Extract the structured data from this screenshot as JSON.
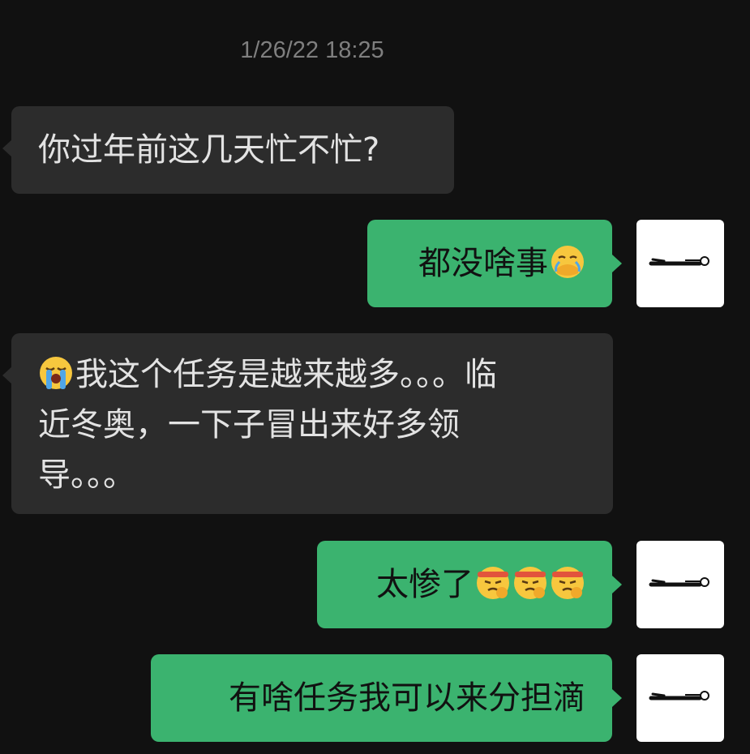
{
  "chat": {
    "timestamp": "1/26/22 18:25",
    "messages": [
      {
        "from": "other",
        "text": "你过年前这几天忙不忙?"
      },
      {
        "from": "me",
        "text": "都没啥事",
        "emoji": [
          "face-in-hand-crying-icon"
        ]
      },
      {
        "from": "other",
        "emoji_leading": "loudly-crying-face-icon",
        "lines": [
          "我这个任务是越来越多。。。临",
          "近冬奥，一下子冒出来好多领",
          "导。。。"
        ]
      },
      {
        "from": "me",
        "text": "太惨了",
        "emoji": [
          "headband-punch-face-icon",
          "headband-punch-face-icon",
          "headband-punch-face-icon"
        ]
      },
      {
        "from": "me",
        "text": "有啥任务我可以来分担滴"
      }
    ]
  },
  "avatar": {
    "icon": "stick-figure-lying-icon"
  },
  "colors": {
    "background": "#111111",
    "incoming_bubble": "#2c2c2c",
    "outgoing_bubble": "#3bb36f",
    "incoming_text": "#e3e3e3",
    "outgoing_text": "#111111",
    "timestamp_text": "#7f7f7f"
  }
}
